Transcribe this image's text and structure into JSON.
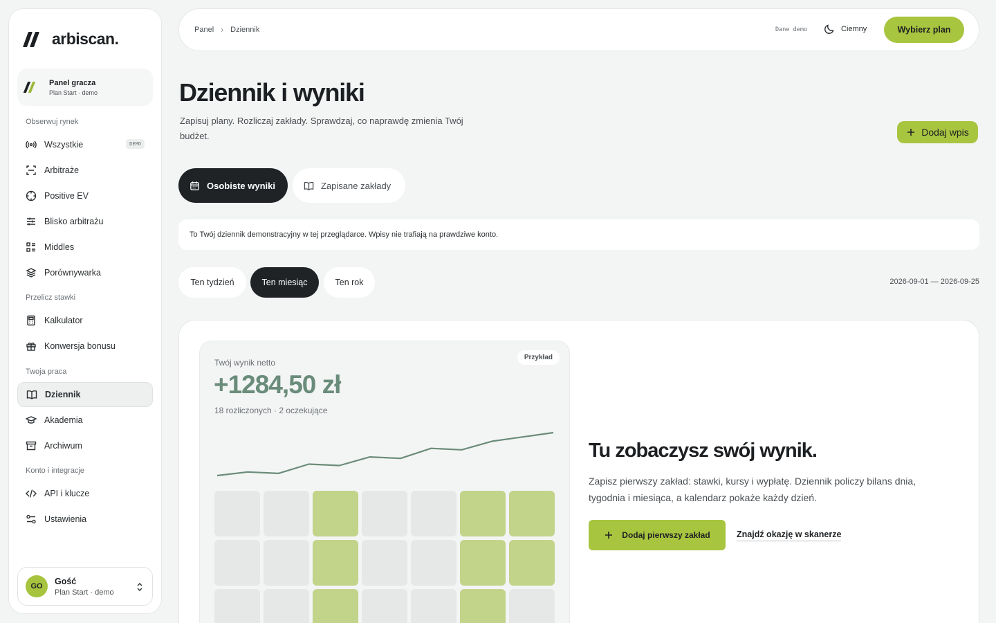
{
  "brand": {
    "name": "arbiscan."
  },
  "player": {
    "title": "Panel gracza",
    "subtitle": "Plan Start · demo"
  },
  "sidebar": {
    "sections": [
      {
        "label": "Obserwuj rynek"
      },
      {
        "label": "Przelicz stawki"
      },
      {
        "label": "Twoja praca"
      },
      {
        "label": "Konto i integracje"
      }
    ],
    "items": [
      {
        "label": "Wszystkie",
        "icon": "broadcast-icon",
        "badge": "DEMO"
      },
      {
        "label": "Arbitraże",
        "icon": "scan-icon"
      },
      {
        "label": "Positive EV",
        "icon": "target-icon"
      },
      {
        "label": "Blisko arbitrażu",
        "icon": "sliders-icon"
      },
      {
        "label": "Middles",
        "icon": "list-icon"
      },
      {
        "label": "Porównywarka",
        "icon": "layers-icon"
      },
      {
        "label": "Kalkulator",
        "icon": "calculator-icon"
      },
      {
        "label": "Konwersja bonusu",
        "icon": "gift-icon"
      },
      {
        "label": "Dziennik",
        "icon": "book-icon",
        "active": true
      },
      {
        "label": "Akademia",
        "icon": "graduation-cap-icon"
      },
      {
        "label": "Archiwum",
        "icon": "archive-icon"
      },
      {
        "label": "API i klucze",
        "icon": "code-icon"
      },
      {
        "label": "Ustawienia",
        "icon": "settings-icon"
      }
    ]
  },
  "user": {
    "initials": "GO",
    "name": "Gość",
    "plan": "Plan Start · demo"
  },
  "topbar": {
    "breadcrumb": [
      "Panel",
      "Dziennik"
    ],
    "demo_label": "Dane demo",
    "theme_label": "Ciemny",
    "plan_button": "Wybierz plan"
  },
  "page": {
    "title": "Dziennik i wyniki",
    "subtitle": "Zapisuj plany. Rozliczaj zakłady. Sprawdzaj, co naprawdę zmienia Twój budżet.",
    "add_entry": "Dodaj wpis",
    "tabs": [
      {
        "label": "Osobiste wyniki",
        "icon": "calendar-icon",
        "active": true
      },
      {
        "label": "Zapisane zakłady",
        "icon": "book-icon",
        "active": false
      }
    ],
    "notice": "To Twój dziennik demonstracyjny w tej przeglądarce. Wpisy nie trafiają na prawdziwe konto.",
    "periods": [
      {
        "label": "Ten tydzień",
        "active": false
      },
      {
        "label": "Ten miesiąc",
        "active": true
      },
      {
        "label": "Ten rok",
        "active": false
      }
    ],
    "date_range": "2026-09-01 — 2026-09-25"
  },
  "result": {
    "label": "Twój wynik netto",
    "badge": "Przykład",
    "value": "+1284,50 zł",
    "count": "18 rozliczonych · 2 oczekujące",
    "accent": "#6a8c7a",
    "trend": [
      2,
      7,
      5,
      18,
      16,
      28,
      26,
      40,
      38,
      50,
      56,
      62
    ],
    "calendar": [
      0,
      0,
      1,
      0,
      0,
      1,
      1,
      0,
      0,
      1,
      0,
      0,
      1,
      1,
      0,
      0,
      1,
      0,
      0,
      1,
      0
    ]
  },
  "empty": {
    "title": "Tu zobaczysz swój wynik.",
    "text": "Zapisz pierwszy zakład: stawki, kursy i wypłatę. Dziennik policzy bilans dnia, tygodnia i miesiąca, a kalendarz pokaże każdy dzień.",
    "cta": "Dodaj pierwszy zakład",
    "link": "Znajdź okazję w skanerze"
  },
  "colors": {
    "accent": "#a8c53f",
    "dark": "#1f2326",
    "positive": "#6a8c7a"
  }
}
